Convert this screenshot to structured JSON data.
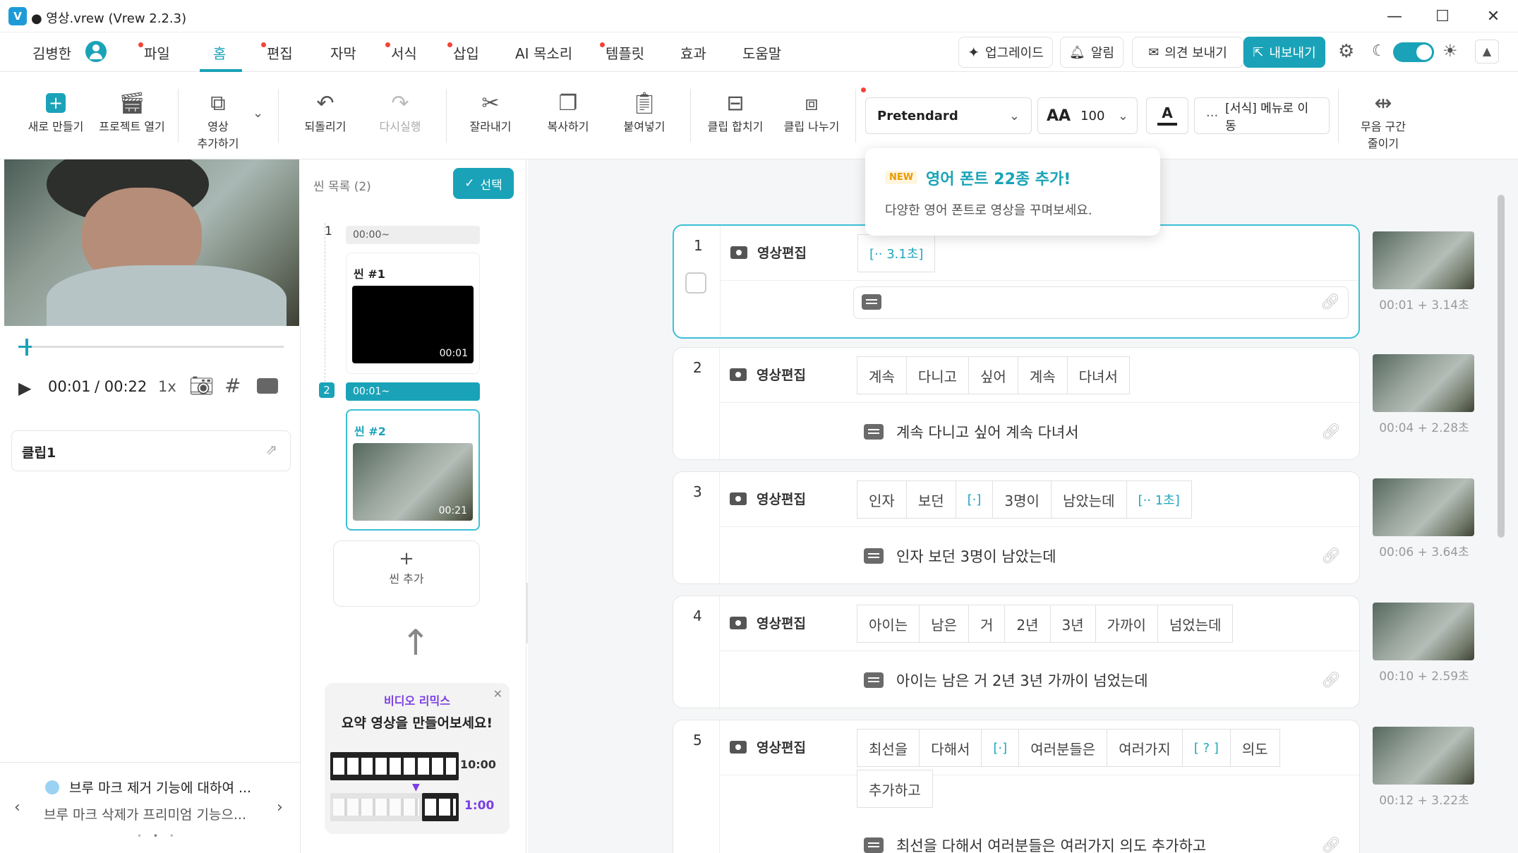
{
  "window": {
    "title": "● 영상.vrew (Vrew 2.2.3)",
    "app_icon": "V"
  },
  "menubar": {
    "user": "김병한",
    "items": [
      {
        "label": "파일",
        "dot": true
      },
      {
        "label": "홈",
        "dot": false
      },
      {
        "label": "편집",
        "dot": true
      },
      {
        "label": "자막",
        "dot": false
      },
      {
        "label": "서식",
        "dot": true
      },
      {
        "label": "삽입",
        "dot": true
      },
      {
        "label": "AI 목소리",
        "dot": false
      },
      {
        "label": "템플릿",
        "dot": true
      },
      {
        "label": "효과",
        "dot": false
      },
      {
        "label": "도움말",
        "dot": false
      }
    ],
    "upgrade": "업그레이드",
    "alarm": "알림",
    "feedback": "의견 보내기",
    "export": "내보내기"
  },
  "toolbar": {
    "new": "새로 만들기",
    "open": "프로젝트 열기",
    "add_video_1": "영상",
    "add_video_2": "추가하기",
    "undo": "되돌리기",
    "redo": "다시실행",
    "cut": "잘라내기",
    "copy": "복사하기",
    "paste": "붙여넣기",
    "merge": "클립 합치기",
    "split": "클립 나누기",
    "font": "Pretendard",
    "font_size": "100",
    "format_menu": "[서식] 메뉴로 이동",
    "silence_1": "무음 구간",
    "silence_2": "줄이기"
  },
  "popup": {
    "badge": "NEW",
    "title": "영어 폰트 22종 추가!",
    "desc": "다양한 영어 폰트로 영상을 꾸며보세요."
  },
  "player": {
    "current": "00:01",
    "total": "/ 00:22",
    "speed": "1x",
    "progress": 0.05
  },
  "clip": {
    "name": "클립1"
  },
  "notice": {
    "title": "브루 마크 제거 기능에 대하여 ...",
    "desc": "브루 마크 삭제가 프리미엄 기능으..."
  },
  "scenes": {
    "header": "씬 목록 (2)",
    "select": "선택",
    "items": [
      {
        "num": "1",
        "time": "00:00~",
        "name": "씬 #1",
        "duration": "00:01"
      },
      {
        "num": "2",
        "time": "00:01~",
        "name": "씬 #2",
        "duration": "00:21"
      }
    ],
    "add": "씬 추가"
  },
  "remix": {
    "label": "비디오 리믹스",
    "title": "요약 영상을 만들어보세요!",
    "long": "10:00",
    "short": "1:00"
  },
  "clips": [
    {
      "num": "1",
      "label": "영상편집",
      "words": [
        "[·· 3.1초]"
      ],
      "pauses": [
        0
      ],
      "subtitle": "",
      "time": "00:01 + 3.14초"
    },
    {
      "num": "2",
      "label": "영상편집",
      "words": [
        "계속",
        "다니고",
        "싶어",
        "계속",
        "다녀서"
      ],
      "pauses": [],
      "subtitle": "계속 다니고 싶어 계속 다녀서",
      "time": "00:04 + 2.28초"
    },
    {
      "num": "3",
      "label": "영상편집",
      "words": [
        "인자",
        "보던",
        "[·]",
        "3명이",
        "남았는데",
        "[·· 1초]"
      ],
      "pauses": [
        2,
        5
      ],
      "subtitle": "인자 보던 3명이 남았는데",
      "time": "00:06 + 3.64초"
    },
    {
      "num": "4",
      "label": "영상편집",
      "words": [
        "아이는",
        "남은",
        "거",
        "2년",
        "3년",
        "가까이",
        "넘었는데"
      ],
      "pauses": [],
      "subtitle": "아이는 남은 거 2년 3년 가까이 넘었는데",
      "time": "00:10 + 2.59초"
    },
    {
      "num": "5",
      "label": "영상편집",
      "words": [
        "최선을",
        "다해서",
        "[·]",
        "여러분들은",
        "여러가지",
        "[ ? ]",
        "의도",
        "추가하고"
      ],
      "pauses": [
        2,
        5
      ],
      "subtitle": "최선을 다해서 여러분들은 여러가지 의도 추가하고",
      "time": "00:12 + 3.22초"
    }
  ],
  "colors": {
    "accent": "#1aa3b8",
    "export": "#1aa3b8",
    "purple": "#7b3fe4"
  }
}
